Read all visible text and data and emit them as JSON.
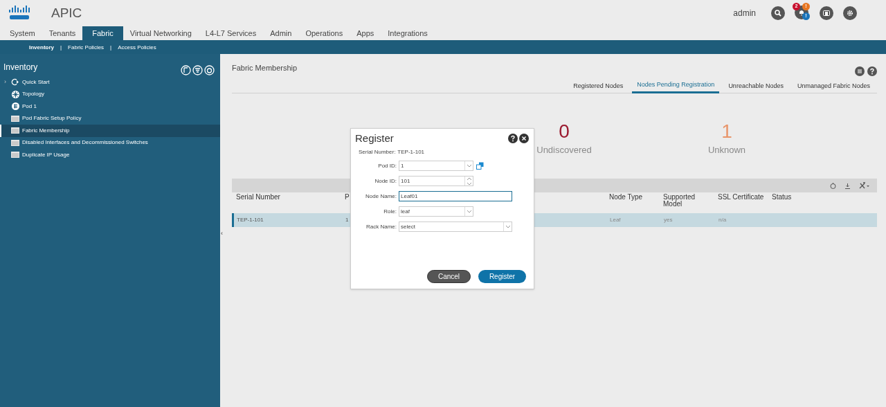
{
  "header": {
    "brand": "APIC",
    "user": "admin",
    "badges": [
      {
        "text": "2",
        "color": "#c8102e"
      },
      {
        "text": "!",
        "color": "#e87722"
      },
      {
        "text": "!",
        "color": "#1b75bb"
      }
    ]
  },
  "nav_tabs": [
    {
      "label": "System",
      "selected": false
    },
    {
      "label": "Tenants",
      "selected": false
    },
    {
      "label": "Fabric",
      "selected": true
    },
    {
      "label": "Virtual Networking",
      "selected": false
    },
    {
      "label": "L4-L7 Services",
      "selected": false
    },
    {
      "label": "Admin",
      "selected": false
    },
    {
      "label": "Operations",
      "selected": false
    },
    {
      "label": "Apps",
      "selected": false
    },
    {
      "label": "Integrations",
      "selected": false
    }
  ],
  "sub_nav_separator": "|",
  "collapse_handle": "‹",
  "sub_nav": [
    {
      "label": "Inventory",
      "selected": true
    },
    {
      "label": "Fabric Policies",
      "selected": false
    },
    {
      "label": "Access Policies",
      "selected": false
    }
  ],
  "sidebar": {
    "title": "Inventory",
    "items": [
      {
        "label": "Quick Start",
        "kind": "quickstart",
        "caret": "›",
        "selected": false
      },
      {
        "label": "Topology",
        "kind": "topology",
        "selected": false
      },
      {
        "label": "Pod 1",
        "kind": "pod",
        "selected": false
      },
      {
        "label": "Pod Fabric Setup Policy",
        "kind": "folder",
        "selected": false
      },
      {
        "label": "Fabric Membership",
        "kind": "folder",
        "selected": true
      },
      {
        "label": "Disabled Interfaces and Decommissioned Switches",
        "kind": "folder",
        "selected": false
      },
      {
        "label": "Duplicate IP Usage",
        "kind": "folder",
        "selected": false
      }
    ]
  },
  "main": {
    "title": "Fabric Membership",
    "tabs": [
      {
        "label": "Registered Nodes",
        "selected": false
      },
      {
        "label": "Nodes Pending Registration",
        "selected": true
      },
      {
        "label": "Unreachable Nodes",
        "selected": false
      },
      {
        "label": "Unmanaged Fabric Nodes",
        "selected": false
      }
    ],
    "stats": [
      {
        "value": "0",
        "label": "Undiscovered",
        "color": "#9b1b30"
      },
      {
        "value": "1",
        "label": "Unknown",
        "color": "#e8956a"
      }
    ],
    "table": {
      "columns": [
        "Serial Number",
        "P",
        "",
        "Node Type",
        "Supported Model",
        "SSL Certificate",
        "Status"
      ],
      "rows": [
        {
          "cells": [
            "TEP-1-101",
            "1",
            "",
            "Leaf",
            "yes",
            "n/a",
            ""
          ],
          "selected": true
        }
      ]
    }
  },
  "dialog": {
    "title": "Register",
    "serial_label": "Serial Number:",
    "serial_value": "TEP-1-101",
    "fields": [
      {
        "label": "Pod ID:",
        "value": "1",
        "kind": "select",
        "short": true,
        "extra": true
      },
      {
        "label": "Node ID:",
        "value": "101",
        "kind": "spinner",
        "short": true
      },
      {
        "label": "Node Name:",
        "value": "Leaf01",
        "kind": "text",
        "focused": true
      },
      {
        "label": "Role:",
        "value": "leaf",
        "kind": "select",
        "short": true
      },
      {
        "label": "Rack Name:",
        "value": "select",
        "kind": "select"
      }
    ],
    "buttons": [
      {
        "label": "Cancel",
        "kind": "secondary"
      },
      {
        "label": "Register",
        "kind": "primary"
      }
    ]
  }
}
